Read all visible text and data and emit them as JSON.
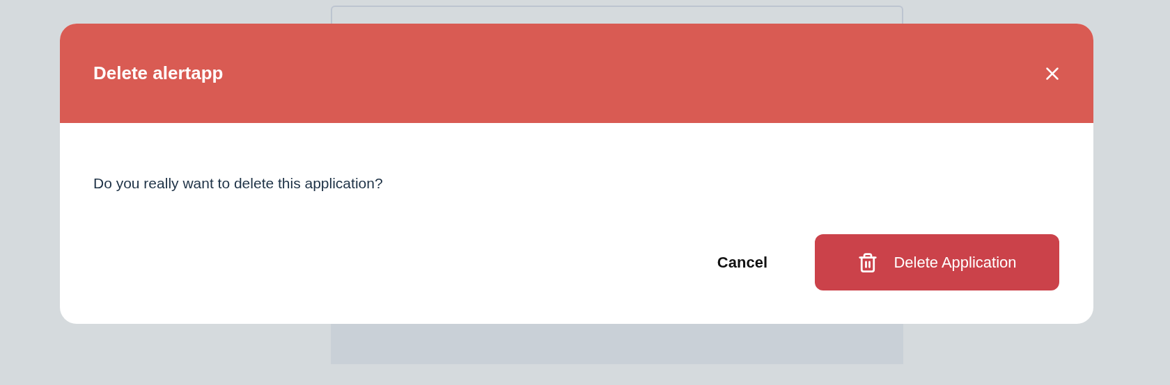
{
  "dialog": {
    "title": "Delete alertapp",
    "message": "Do you really want to delete this application?",
    "cancel_button": {
      "label": "Cancel"
    },
    "delete_button": {
      "label": "Delete Application"
    }
  }
}
